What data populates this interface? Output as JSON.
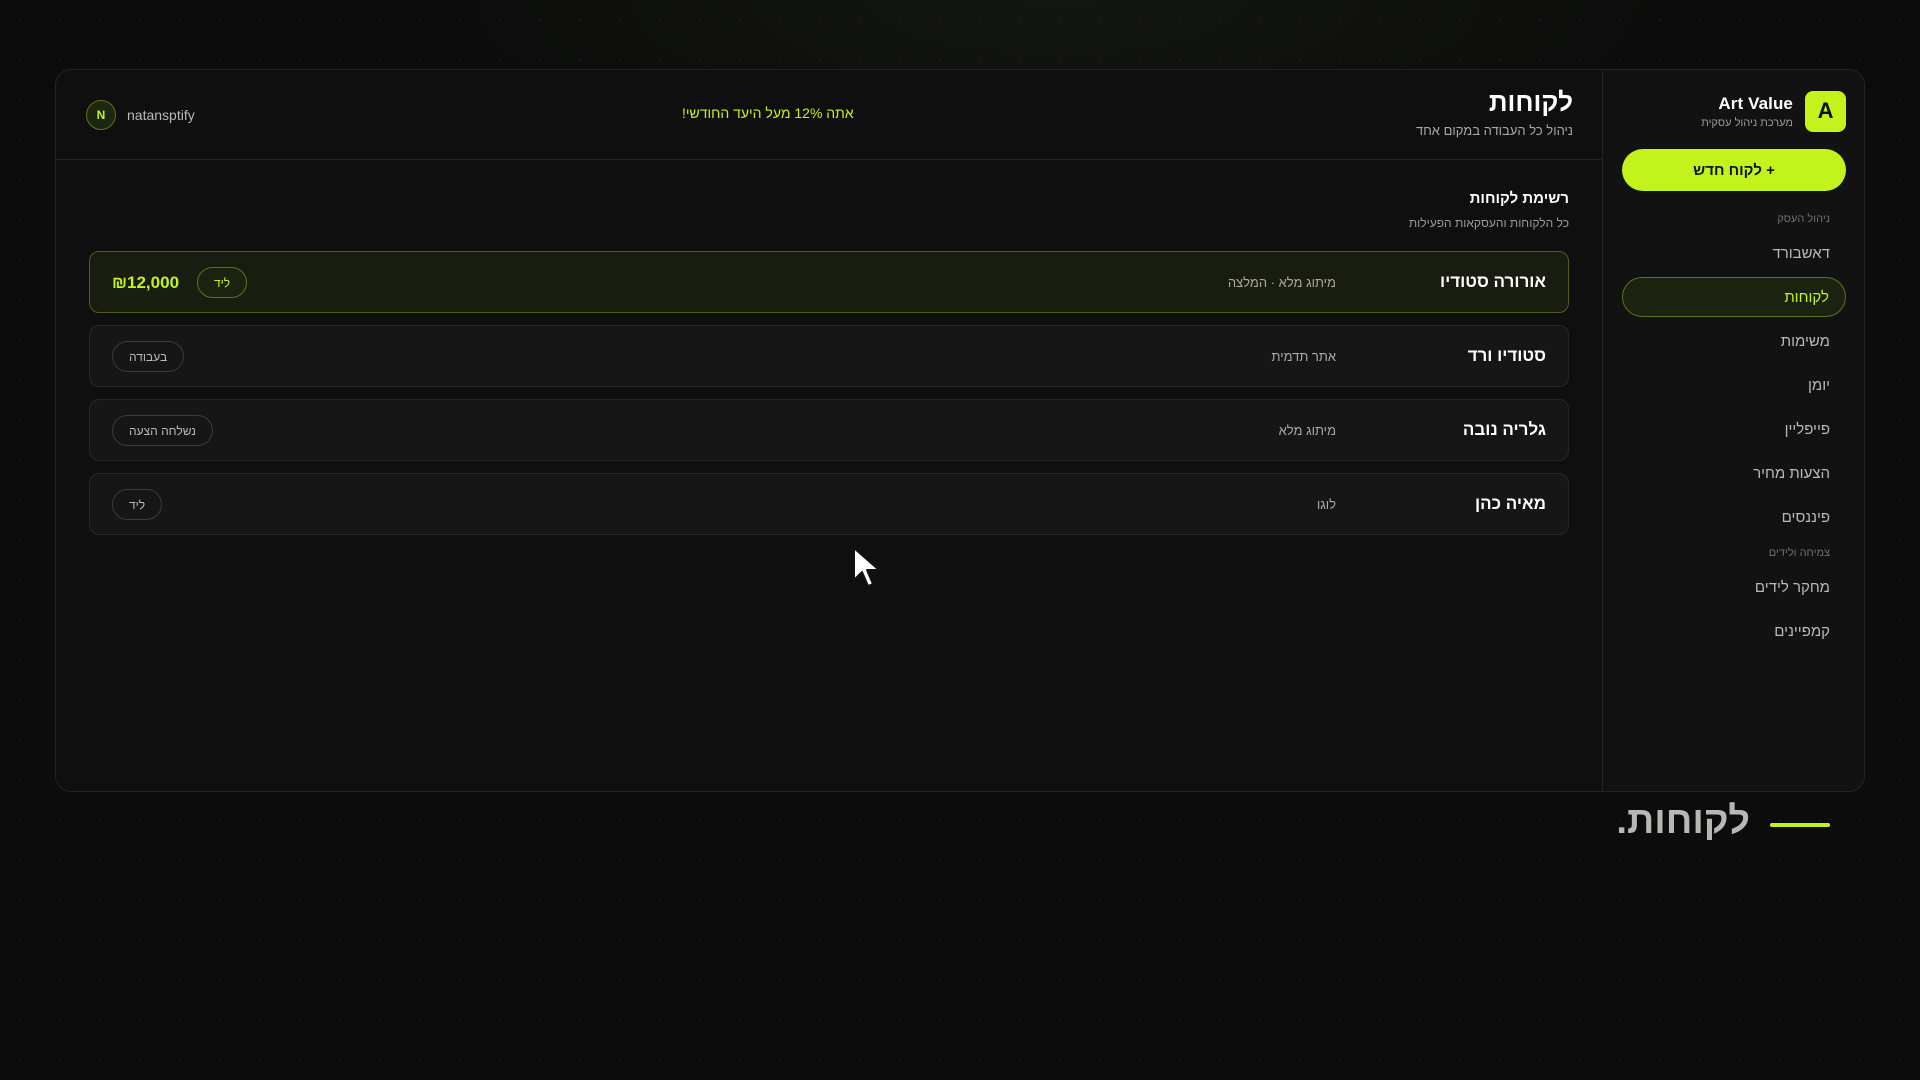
{
  "brand": {
    "logo_letter": "A",
    "name": "Art Value",
    "subtitle": "מערכת ניהול עסקית"
  },
  "sidebar": {
    "new_client_button": "+ לקוח חדש",
    "section_business": "ניהול העסק",
    "section_growth": "צמיחה ולידים",
    "business_items": [
      {
        "label": "דאשבורד",
        "active": false
      },
      {
        "label": "לקוחות",
        "active": true
      },
      {
        "label": "משימות",
        "active": false
      },
      {
        "label": "יומן",
        "active": false
      },
      {
        "label": "פייפליין",
        "active": false
      },
      {
        "label": "הצעות מחיר",
        "active": false
      },
      {
        "label": "פיננסים",
        "active": false
      }
    ],
    "growth_items": [
      {
        "label": "מחקר לידים"
      },
      {
        "label": "קמפיינים"
      }
    ]
  },
  "header": {
    "title": "לקוחות",
    "subtitle": "ניהול כל העבודה במקום אחד",
    "goal_note": "אתה 12% מעל היעד החודשי!",
    "user": {
      "initial": "N",
      "name": "natansptify"
    }
  },
  "client_list": {
    "title": "רשימת לקוחות",
    "subtitle": "כל הלקוחות והעסקאות הפעילות",
    "clients": [
      {
        "name": "אורורה סטודיו",
        "service": "מיתוג מלא · המלצה",
        "status": "ליד",
        "amount": "₪12,000",
        "highlighted": true
      },
      {
        "name": "סטודיו ורד",
        "service": "אתר תדמית",
        "status": "בעבודה",
        "amount": "",
        "highlighted": false
      },
      {
        "name": "גלריה נובה",
        "service": "מיתוג מלא",
        "status": "נשלחה הצעה",
        "amount": "",
        "highlighted": false
      },
      {
        "name": "מאיה כהן",
        "service": "לוגו",
        "status": "ליד",
        "amount": "",
        "highlighted": false
      }
    ]
  },
  "caption": {
    "text": "לקוחות."
  },
  "colors": {
    "accent": "#c2f31c",
    "background": "#0b0c0b",
    "panel": "#0e0f0e"
  }
}
